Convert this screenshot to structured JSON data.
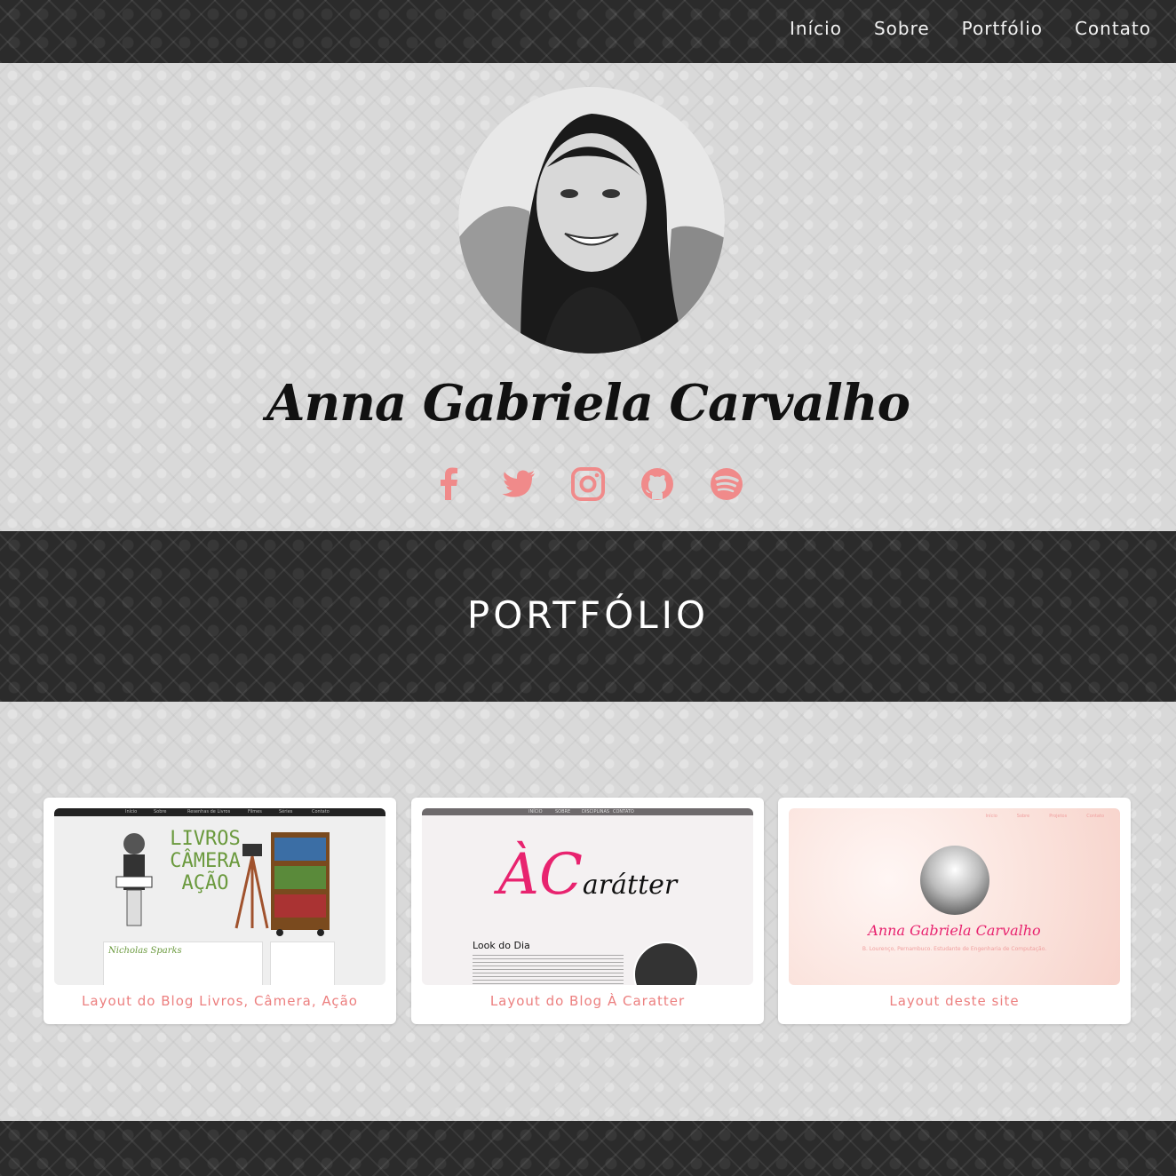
{
  "nav": {
    "items": [
      {
        "label": "Início"
      },
      {
        "label": "Sobre"
      },
      {
        "label": "Portfólio"
      },
      {
        "label": "Contato"
      }
    ]
  },
  "hero": {
    "name": "Anna Gabriela Carvalho",
    "social_icons": [
      "facebook-icon",
      "twitter-icon",
      "instagram-icon",
      "github-icon",
      "spotify-icon"
    ],
    "icon_color": "#f08a8a"
  },
  "portfolio": {
    "title": "PORTFÓLIO",
    "cards": [
      {
        "caption": "Layout do Blog Livros, Câmera, Ação",
        "thumb": {
          "nav": [
            "Início",
            "Sobre",
            "Resenhas de Livros",
            "Filmes",
            "Séries",
            "Contato"
          ],
          "title_lines": [
            "LIVROS",
            "CÂMERA",
            "AÇÃO"
          ],
          "post_title": "Nicholas Sparks"
        }
      },
      {
        "caption": "Layout do Blog À Caratter",
        "thumb": {
          "nav": [
            "INÍCIO",
            "SOBRE",
            "DISCIPLINAS",
            "CONTATO"
          ],
          "logo_big": "ÀC",
          "logo_small": "arátter",
          "post_title": "Look do Dia"
        }
      },
      {
        "caption": "Layout deste site",
        "thumb": {
          "nav": [
            "Início",
            "Sobre",
            "Projetos",
            "Contato"
          ],
          "name": "Anna Gabriela Carvalho",
          "subtitle": "B. Lourenço, Pernambuco. Estudante de Engenharia de Computação."
        }
      }
    ]
  },
  "colors": {
    "accent": "#f08a8a",
    "caption": "#ec7f7f",
    "dark_band": "#2b2b2b",
    "light_bg": "#d9d9d9"
  }
}
